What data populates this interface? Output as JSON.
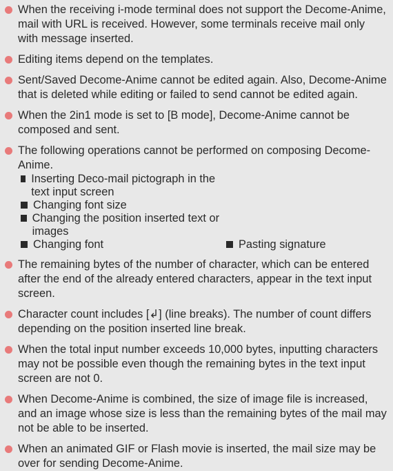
{
  "items": [
    {
      "text": "When the receiving i-mode terminal does not support the Decome-Anime, mail with URL is received. However, some terminals receive mail only with message inserted."
    },
    {
      "text": "Editing items depend on the templates."
    },
    {
      "text": "Sent/Saved Decome-Anime cannot be edited again. Also, Decome-Anime that is deleted while editing or failed to send cannot be edited again."
    },
    {
      "text": "When the 2in1 mode is set to [B mode], Decome-Anime cannot be composed and sent."
    },
    {
      "text": "The following operations cannot be performed on composing Decome-Anime.",
      "sub_items": [
        "Inserting Deco-mail pictograph in the text input screen",
        "Changing font size",
        "Changing the position inserted text or images",
        "Changing font",
        "Pasting signature"
      ]
    },
    {
      "text": "The remaining bytes of the number of character, which can be entered after the end of the already entered characters, appear in the text input screen."
    },
    {
      "text": "Character count includes [↲] (line breaks). The number of count differs depending on the position inserted line break."
    },
    {
      "text": "When the total input number exceeds 10,000 bytes, inputting characters may not be possible even though the remaining bytes in the text input screen are not 0."
    },
    {
      "text": "When Decome-Anime is combined, the size of image file is increased, and an image whose size is less than the remaining bytes of the mail may not be able to be inserted."
    },
    {
      "text": "When an animated GIF or Flash movie is inserted, the mail size may be over for sending Decome-Anime."
    }
  ],
  "colors": {
    "bullet": "#e87a7a",
    "background": "#e8e8e8",
    "text": "#2a2a2a"
  }
}
